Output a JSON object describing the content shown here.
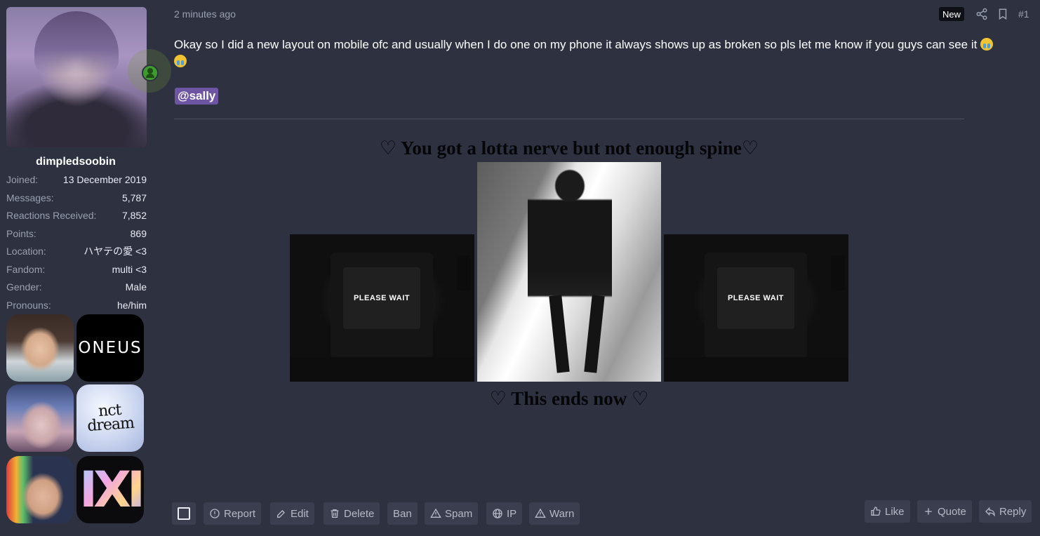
{
  "user": {
    "name": "dimpledsoobin",
    "fields": [
      {
        "key": "Joined:",
        "value": "13 December 2019"
      },
      {
        "key": "Messages:",
        "value": "5,787"
      },
      {
        "key": "Reactions Received:",
        "value": "7,852"
      },
      {
        "key": "Points:",
        "value": "869"
      },
      {
        "key": "Location:",
        "value": "ハヤテの愛 <3"
      },
      {
        "key": "Fandom:",
        "value": "multi <3"
      },
      {
        "key": "Gender:",
        "value": "Male"
      },
      {
        "key": "Pronouns:",
        "value": "he/him"
      }
    ],
    "badges": {
      "oneus": "ONEUS",
      "nct_dream": "nct dream",
      "monsta_x": "IXI"
    }
  },
  "post": {
    "time": "2 minutes ago",
    "new_label": "New",
    "number": "#1",
    "text": "Okay so I did a new layout on mobile ofc and usually when I do one on my phone it always shows up as broken so pls let me know if you guys can see it",
    "mention": "@sally",
    "heading_top": "♡ You got a lotta nerve but not enough spine♡",
    "heading_bottom": "♡ This ends now ♡",
    "tv_text": "PLEASE WAIT"
  },
  "actions": {
    "report": "Report",
    "edit": "Edit",
    "delete": "Delete",
    "ban": "Ban",
    "spam": "Spam",
    "ip": "IP",
    "warn": "Warn",
    "like": "Like",
    "quote": "Quote",
    "reply": "Reply"
  }
}
